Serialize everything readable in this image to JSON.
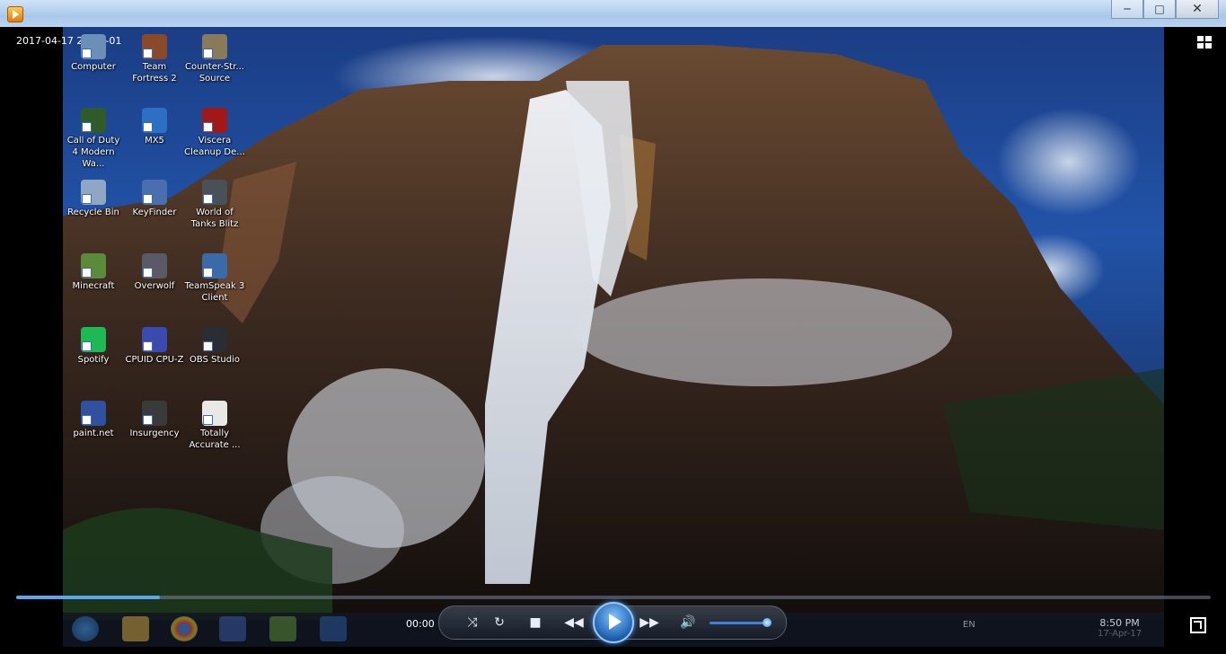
{
  "player": {
    "timestamp": "2017-04-17 20-50-01",
    "current_time": "00:00",
    "seek_progress": 0.12,
    "volume_level": 0.85
  },
  "window_buttons": {
    "minimize": "─",
    "maximize": "□",
    "close": "✕"
  },
  "desktop_icons": [
    {
      "label": "Computer",
      "color": "#6b8fb8"
    },
    {
      "label": "Team Fortress 2",
      "color": "#8a4a2a"
    },
    {
      "label": "Counter-Str... Source",
      "color": "#8a7a5a"
    },
    {
      "label": "Call of Duty 4 Modern Wa...",
      "color": "#2f5a2a"
    },
    {
      "label": "MX5",
      "color": "#2c6fc4"
    },
    {
      "label": "Viscera Cleanup De...",
      "color": "#a01818"
    },
    {
      "label": "Recycle Bin",
      "color": "#8fa6c4"
    },
    {
      "label": "KeyFinder",
      "color": "#4a6fb0"
    },
    {
      "label": "World of Tanks Blitz",
      "color": "#4a5058"
    },
    {
      "label": "Minecraft",
      "color": "#5a8a3a"
    },
    {
      "label": "Overwolf",
      "color": "#5a5a66"
    },
    {
      "label": "TeamSpeak 3 Client",
      "color": "#3a6aa8"
    },
    {
      "label": "Spotify",
      "color": "#1db954"
    },
    {
      "label": "CPUID CPU-Z",
      "color": "#3a4ab0"
    },
    {
      "label": "OBS Studio",
      "color": "#2a2d33"
    },
    {
      "label": "paint.net",
      "color": "#3050a0"
    },
    {
      "label": "Insurgency",
      "color": "#3a3a3a"
    },
    {
      "label": "Totally Accurate ...",
      "color": "#e8e8e8"
    }
  ],
  "tray": {
    "language": "EN",
    "clock_time": "8:50 PM",
    "clock_date": "17-Apr-17"
  },
  "colors": {
    "accent": "#1d5fae",
    "seek_fill": "#5aa7ef"
  }
}
